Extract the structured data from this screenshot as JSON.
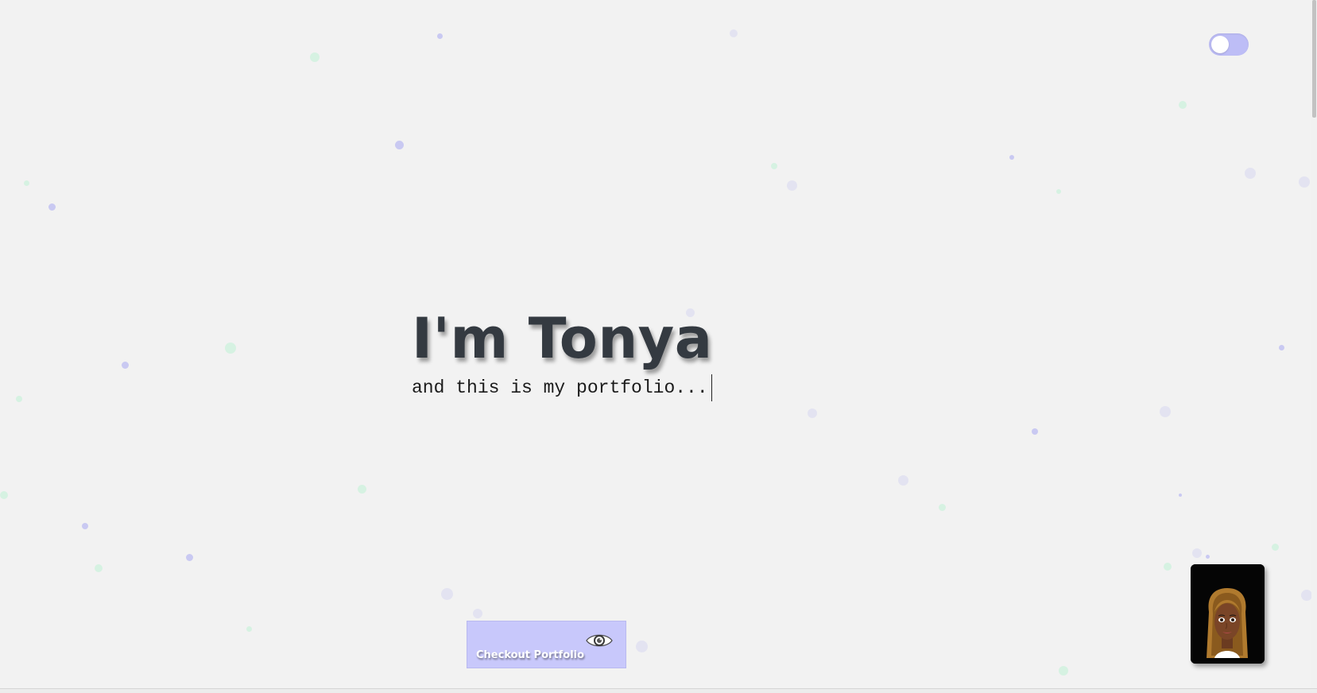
{
  "hero": {
    "title": "I'm Tonya",
    "subtitle": "and this is my portfolio..."
  },
  "cta": {
    "label": "Checkout Portfolio",
    "icon": "eye-icon"
  },
  "theme_toggle": {
    "state": "off",
    "icon": "toggle-switch"
  },
  "avatar": {
    "icon": "avatar-icon"
  },
  "colors": {
    "background": "#f2f2f2",
    "accent": "#c8c8fb",
    "title": "#343a41",
    "particle_purple": "#c9c9f2",
    "particle_green": "#d6f2e2"
  }
}
